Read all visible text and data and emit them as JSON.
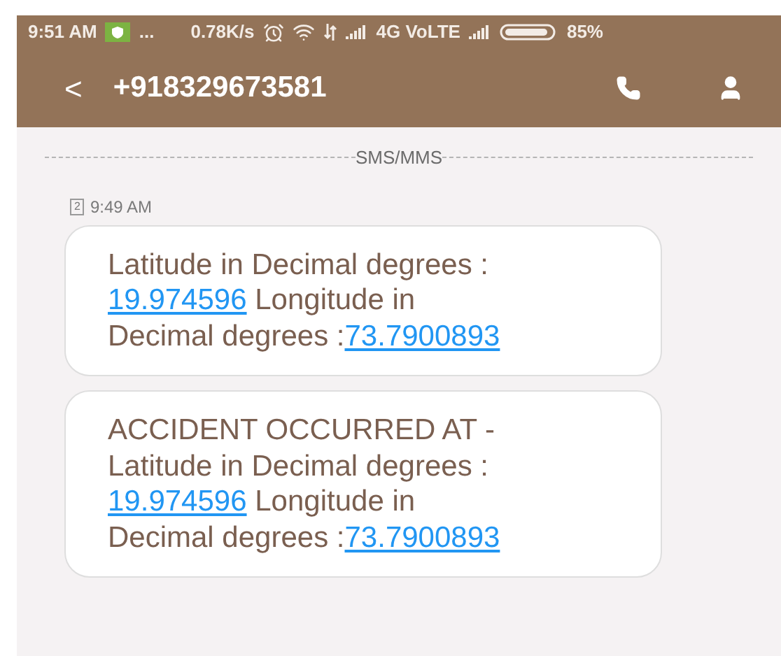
{
  "status_bar": {
    "time": "9:51 AM",
    "more": "...",
    "speed": "0.78K/s",
    "network": "4G VoLTE",
    "battery": "85%"
  },
  "header": {
    "back": "<",
    "title": "+918329673581"
  },
  "divider_label": "SMS/MMS",
  "message_meta": {
    "sim": "2",
    "time": "9:49 AM"
  },
  "messages": [
    {
      "parts": [
        {
          "text": "Latitude in Decimal degrees : "
        },
        {
          "link": "19.974596"
        },
        {
          "text": " Longitude in Decimal degrees :"
        },
        {
          "link": "73.7900893"
        }
      ]
    },
    {
      "parts": [
        {
          "text": "ACCIDENT OCCURRED AT - Latitude in Decimal degrees : "
        },
        {
          "link": "19.974596"
        },
        {
          "text": " Longitude in Decimal degrees :"
        },
        {
          "link": "73.7900893"
        }
      ]
    }
  ]
}
